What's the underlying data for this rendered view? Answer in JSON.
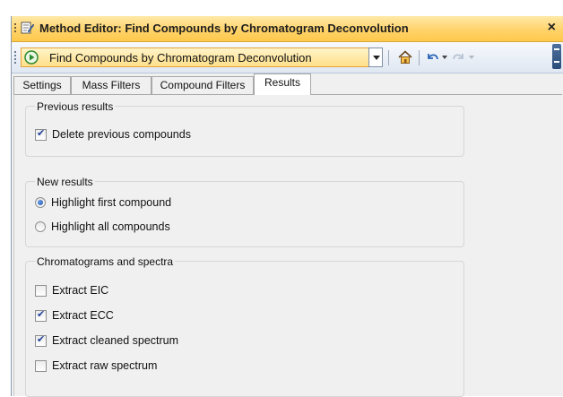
{
  "window": {
    "title": "Method Editor: Find Compounds by Chromatogram Deconvolution",
    "close_symbol": "×"
  },
  "toolbar": {
    "method_name": "Find Compounds by Chromatogram Deconvolution",
    "icons": [
      "play-icon",
      "home-icon",
      "undo-icon",
      "redo-icon"
    ]
  },
  "tabs": [
    {
      "label": "Settings",
      "active": false
    },
    {
      "label": "Mass Filters",
      "active": false
    },
    {
      "label": "Compound Filters",
      "active": false
    },
    {
      "label": "Results",
      "active": true
    }
  ],
  "groups": {
    "previous": {
      "title": "Previous results",
      "options": [
        {
          "label": "Delete previous compounds",
          "checked": true
        }
      ]
    },
    "new": {
      "title": "New results",
      "options": [
        {
          "label": "Highlight first compound",
          "selected": true
        },
        {
          "label": "Highlight all compounds",
          "selected": false
        }
      ]
    },
    "chromatograms": {
      "title": "Chromatograms and spectra",
      "options": [
        {
          "label": "Extract EIC",
          "checked": false
        },
        {
          "label": "Extract ECC",
          "checked": true
        },
        {
          "label": "Extract cleaned spectrum",
          "checked": true
        },
        {
          "label": "Extract raw spectrum",
          "checked": false
        }
      ]
    }
  },
  "colors": {
    "title_bar": "#ffd36a",
    "accent_check": "#23419a",
    "panel_bg": "#f0f0f0"
  }
}
